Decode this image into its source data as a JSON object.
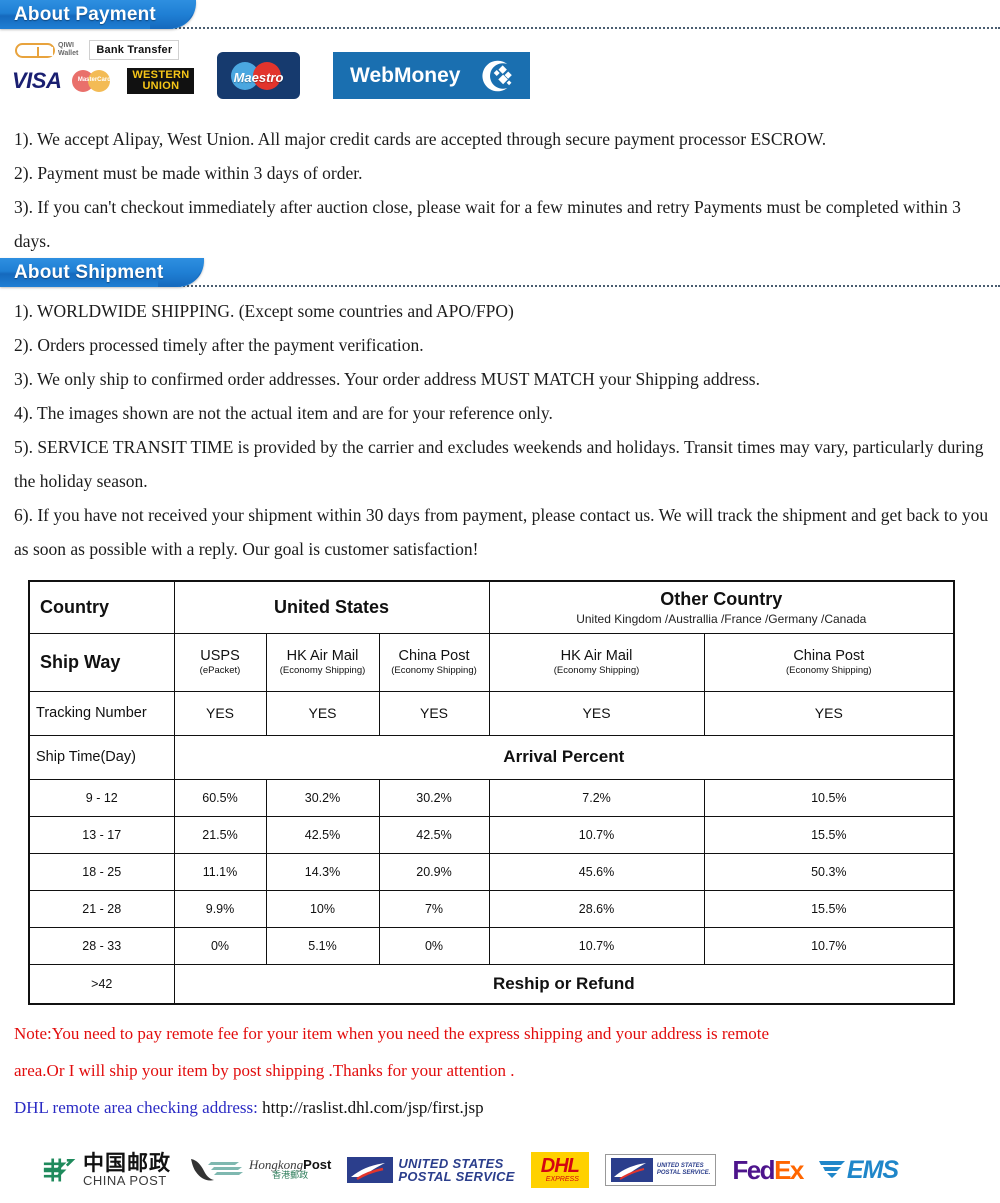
{
  "sections": {
    "payment": {
      "banner": "About Payment",
      "logos": [
        {
          "name": "qiwi-wallet-logo",
          "label_line1": "QIWI",
          "label_line2": "Wallet"
        },
        {
          "name": "bank-transfer-logo",
          "label": "Bank Transfer"
        },
        {
          "name": "visa-logo",
          "label": "VISA"
        },
        {
          "name": "mastercard-logo",
          "label": "MasterCard"
        },
        {
          "name": "western-union-logo",
          "label_line1": "WESTERN",
          "label_line2": "UNION"
        },
        {
          "name": "maestro-logo",
          "label": "Maestro"
        },
        {
          "name": "webmoney-logo",
          "label": "WebMoney"
        }
      ],
      "items": [
        "1). We accept Alipay, West Union. All major credit cards are accepted through secure payment processor ESCROW.",
        "2). Payment must be made within 3 days of order.",
        "3). If you can't checkout immediately after auction close, please wait for a few minutes and retry Payments must be completed within 3 days."
      ]
    },
    "shipment": {
      "banner": "About Shipment",
      "items": [
        "1). WORLDWIDE SHIPPING. (Except some countries and APO/FPO)",
        "2). Orders processed timely after the payment verification.",
        "3). We only ship to confirmed order addresses. Your order address MUST MATCH your Shipping address.",
        "4). The images shown are not the actual item and are for your reference only.",
        "5). SERVICE TRANSIT TIME is provided by the carrier and excludes weekends and holidays. Transit times may vary, particularly during the holiday season.",
        "6). If you have not received your shipment within 30 days from payment, please contact us. We will track the shipment and get back to you as soon as possible with a reply. Our goal is customer satisfaction!"
      ]
    }
  },
  "table": {
    "row_labels": {
      "country": "Country",
      "ship_way": "Ship Way",
      "tracking_number": "Tracking Number",
      "ship_time": "Ship Time(Day)"
    },
    "country_groups": [
      {
        "title": "United States",
        "subtitle": ""
      },
      {
        "title": "Other Country",
        "subtitle": "United Kingdom /Australlia /France /Germany /Canada"
      }
    ],
    "ship_ways": [
      {
        "name": "USPS",
        "sub": "(ePacket)"
      },
      {
        "name": "HK Air Mail",
        "sub": "(Economy Shipping)"
      },
      {
        "name": "China Post",
        "sub": "(Economy Shipping)"
      },
      {
        "name": "HK Air Mail",
        "sub": "(Economy Shipping)"
      },
      {
        "name": "China Post",
        "sub": "(Economy Shipping)"
      }
    ],
    "tracking": [
      "YES",
      "YES",
      "YES",
      "YES",
      "YES"
    ],
    "arrival_percent_title": "Arrival Percent",
    "reship_label": "Reship or Refund",
    "reship_range": ">42",
    "rows": [
      {
        "range": "9 - 12",
        "values": [
          "60.5%",
          "30.2%",
          "30.2%",
          "7.2%",
          "10.5%"
        ]
      },
      {
        "range": "13 - 17",
        "values": [
          "21.5%",
          "42.5%",
          "42.5%",
          "10.7%",
          "15.5%"
        ]
      },
      {
        "range": "18 - 25",
        "values": [
          "11.1%",
          "14.3%",
          "20.9%",
          "45.6%",
          "50.3%"
        ]
      },
      {
        "range": "21 - 28",
        "values": [
          "9.9%",
          "10%",
          "7%",
          "28.6%",
          "15.5%"
        ]
      },
      {
        "range": "28 - 33",
        "values": [
          "0%",
          "5.1%",
          "0%",
          "10.7%",
          "10.7%"
        ]
      }
    ]
  },
  "note": {
    "red_line1": "Note:You need to pay remote fee for your item when you need the express shipping and your address is remote",
    "red_line2": "area.Or I will ship your item by post shipping .Thanks for your attention .",
    "dhl_label": "DHL remote area checking address:",
    "dhl_url": "http://raslist.dhl.com/jsp/first.jsp"
  },
  "carriers": [
    {
      "name": "china-post-logo",
      "cn": "中国邮政",
      "en": "CHINA POST"
    },
    {
      "name": "hongkong-post-logo",
      "en_italic": "Hongkong",
      "en_bold": "Post",
      "cn": "香港郵政"
    },
    {
      "name": "usps-logo",
      "line1": "UNITED STATES",
      "line2": "POSTAL SERVICE"
    },
    {
      "name": "dhl-logo",
      "text": "DHL",
      "sub": "EXPRESS"
    },
    {
      "name": "usps-boxed-logo",
      "line1": "UNITED STATES",
      "line2": "POSTAL SERVICE."
    },
    {
      "name": "fedex-logo",
      "fed": "Fed",
      "ex": "Ex"
    },
    {
      "name": "ems-logo",
      "text": "EMS"
    }
  ],
  "colors": {
    "banner_blue": "#1f7fd4",
    "note_red": "#e20d0d",
    "note_blue": "#2b2bc4",
    "rule_gray": "#4a5d70"
  }
}
